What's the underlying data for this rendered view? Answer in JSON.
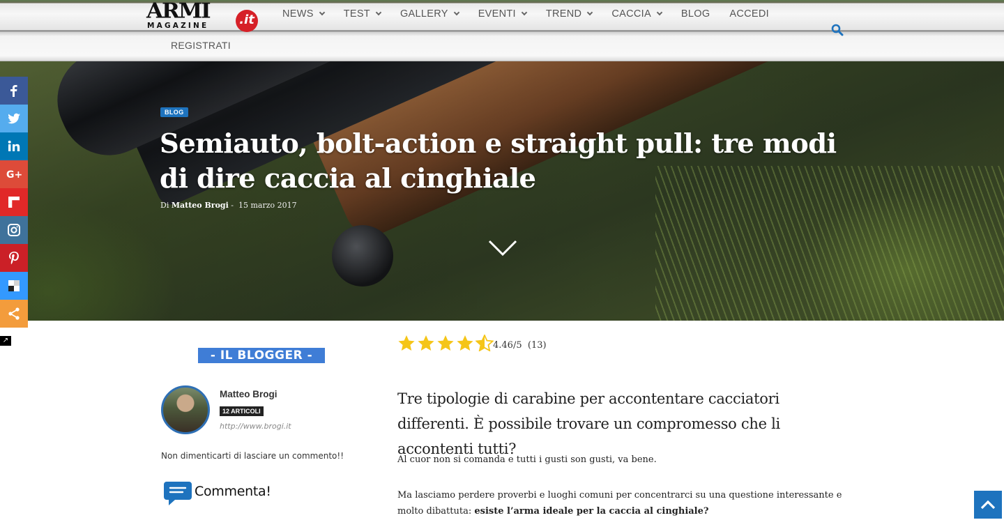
{
  "logo": {
    "word": "ARMI",
    "tagline": "MAGAZINE",
    "suffix": ".it"
  },
  "nav": {
    "items": [
      {
        "label": "NEWS",
        "dropdown": true
      },
      {
        "label": "TEST",
        "dropdown": true
      },
      {
        "label": "GALLERY",
        "dropdown": true
      },
      {
        "label": "EVENTI",
        "dropdown": true
      },
      {
        "label": "TREND",
        "dropdown": true
      },
      {
        "label": "CACCIA",
        "dropdown": true
      },
      {
        "label": "BLOG",
        "dropdown": false
      },
      {
        "label": "ACCEDI",
        "dropdown": false
      }
    ],
    "register": "REGISTRATI",
    "search_icon": "search-icon"
  },
  "hero": {
    "category": "BLOG",
    "title": "Semiauto, bolt-action e straight pull: tre modi di dire caccia al cinghiale",
    "by_prefix": "Di",
    "author": "Matteo Brogi",
    "separator": "-",
    "date": "15 marzo 2017"
  },
  "social": [
    {
      "name": "facebook",
      "glyph": "f",
      "color": "#3b5998"
    },
    {
      "name": "twitter",
      "glyph": "t",
      "color": "#55acee"
    },
    {
      "name": "linkedin",
      "glyph": "in",
      "color": "#0077b5"
    },
    {
      "name": "google-plus",
      "glyph": "G+",
      "color": "#dd4b39"
    },
    {
      "name": "flipboard",
      "glyph": "F",
      "color": "#e12828"
    },
    {
      "name": "instagram",
      "glyph": "ig",
      "color": "#3f729b"
    },
    {
      "name": "pinterest",
      "glyph": "P",
      "color": "#cb2027"
    },
    {
      "name": "delicious",
      "glyph": "d",
      "color": "#3399ff"
    },
    {
      "name": "share",
      "glyph": "s",
      "color": "#f39c3c"
    }
  ],
  "sidebar": {
    "heading": "- IL BLOGGER -",
    "author_name": "Matteo Brogi",
    "articles_badge": "12 ARTICOLI",
    "author_url": "http://www.brogi.it",
    "reminder": "Non dimenticarti di lasciare un commento!!",
    "comment_label": "Commenta!"
  },
  "article": {
    "rating": {
      "value": 4.46,
      "max": 5,
      "text": "4.46/5",
      "count": "(13)"
    },
    "lead": "Tre tipologie di carabine per accontentare cacciatori differenti. È possibile trovare un compromesso che li accontenti tutti?",
    "para1": "Al cuor non si comanda e tutti i gusti son gusti, va bene.",
    "para2_start": "Ma lasciamo perdere proverbi e luoghi comuni per concentrarci su una questione interessante e molto dibattuta: ",
    "para2_bold": "esiste l’arma ideale per la caccia al cinghiale?"
  },
  "colors": {
    "accent": "#1e73be",
    "blogger_heading": "#3f7dd6",
    "star": "#f5c518",
    "logo_red": "#d62027"
  }
}
